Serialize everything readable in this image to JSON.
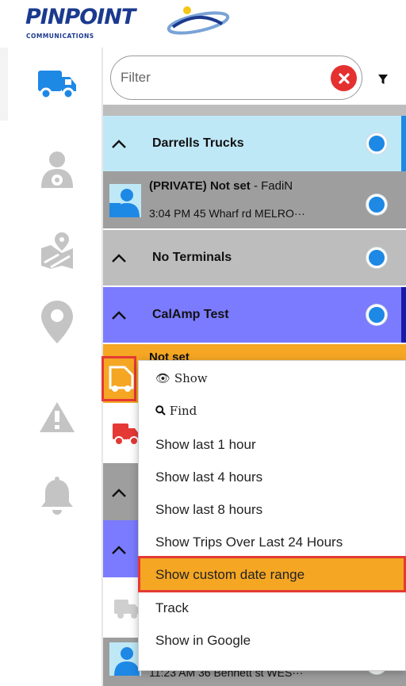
{
  "brand": {
    "name": "PINPOINT",
    "tagline": "COMMUNICATIONS"
  },
  "filter": {
    "placeholder": "Filter",
    "value": ""
  },
  "sidebar": {
    "items": [
      {
        "name": "vehicles",
        "icon": "truck-icon",
        "active": true
      },
      {
        "name": "drivers",
        "icon": "driver-icon"
      },
      {
        "name": "places",
        "icon": "map-pin-icon"
      },
      {
        "name": "locations",
        "icon": "location-pin-icon"
      },
      {
        "name": "alerts",
        "icon": "warning-icon"
      },
      {
        "name": "notifications",
        "icon": "bell-icon"
      }
    ]
  },
  "list": {
    "groups": [
      {
        "title": "Darrells Trucks",
        "color": "#bfe8f7"
      },
      {
        "title": "No Terminals",
        "color": "#bdbdbd"
      },
      {
        "title": "CalAmp Test",
        "color": "#7b7bff"
      }
    ],
    "vehicles": [
      {
        "title": "(PRIVATE) Not set",
        "driver": "FadiN",
        "separator": " - ",
        "status": "3:04 PM 45 Wharf rd MELRO···"
      },
      {
        "title": "Not set"
      },
      {
        "status": "11:23 AM 36 Bennett st WES···"
      }
    ]
  },
  "context_menu": {
    "items": [
      {
        "label": "Show",
        "icon": "eye-icon"
      },
      {
        "label": "Find",
        "icon": "search-icon"
      },
      {
        "label": "Show last 1 hour"
      },
      {
        "label": "Show last 4 hours"
      },
      {
        "label": "Show last 8 hours"
      },
      {
        "label": "Show Trips Over Last 24 Hours"
      },
      {
        "label": "Show custom date range",
        "highlighted": true
      },
      {
        "label": "Track"
      },
      {
        "label": "Show in Google"
      }
    ]
  },
  "colors": {
    "brand_blue": "#1b3a8f",
    "accent_orange": "#f5a623",
    "radio_blue": "#1e88e5",
    "highlight_red": "#e53935"
  }
}
